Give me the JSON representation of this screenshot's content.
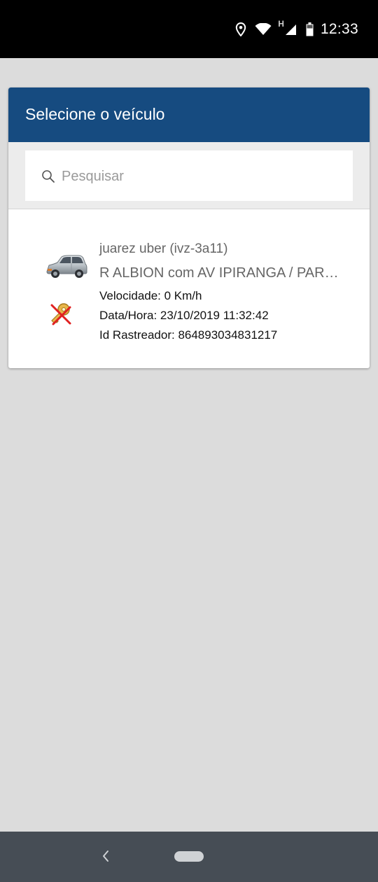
{
  "status_bar": {
    "time": "12:33",
    "network_label": "H",
    "icons": [
      "location-icon",
      "wifi-icon",
      "signal-icon",
      "battery-icon"
    ]
  },
  "dialog": {
    "title": "Selecione o veículo",
    "header_color": "#164b80",
    "search": {
      "placeholder": "Pesquisar",
      "value": ""
    }
  },
  "vehicles": [
    {
      "name": "juarez uber (ivz-3a11)",
      "address": "R ALBION com AV IPIRANGA / PARQUE",
      "speed": "Velocidade: 0 Km/h",
      "datetime": "Data/Hora: 23/10/2019 11:32:42",
      "tracker_id": "Id Rastreador: 864893034831217",
      "icons": [
        "car-icon",
        "ignition-off-key-icon"
      ]
    }
  ],
  "nav_bar": {
    "buttons": [
      "back-button",
      "home-button"
    ]
  }
}
